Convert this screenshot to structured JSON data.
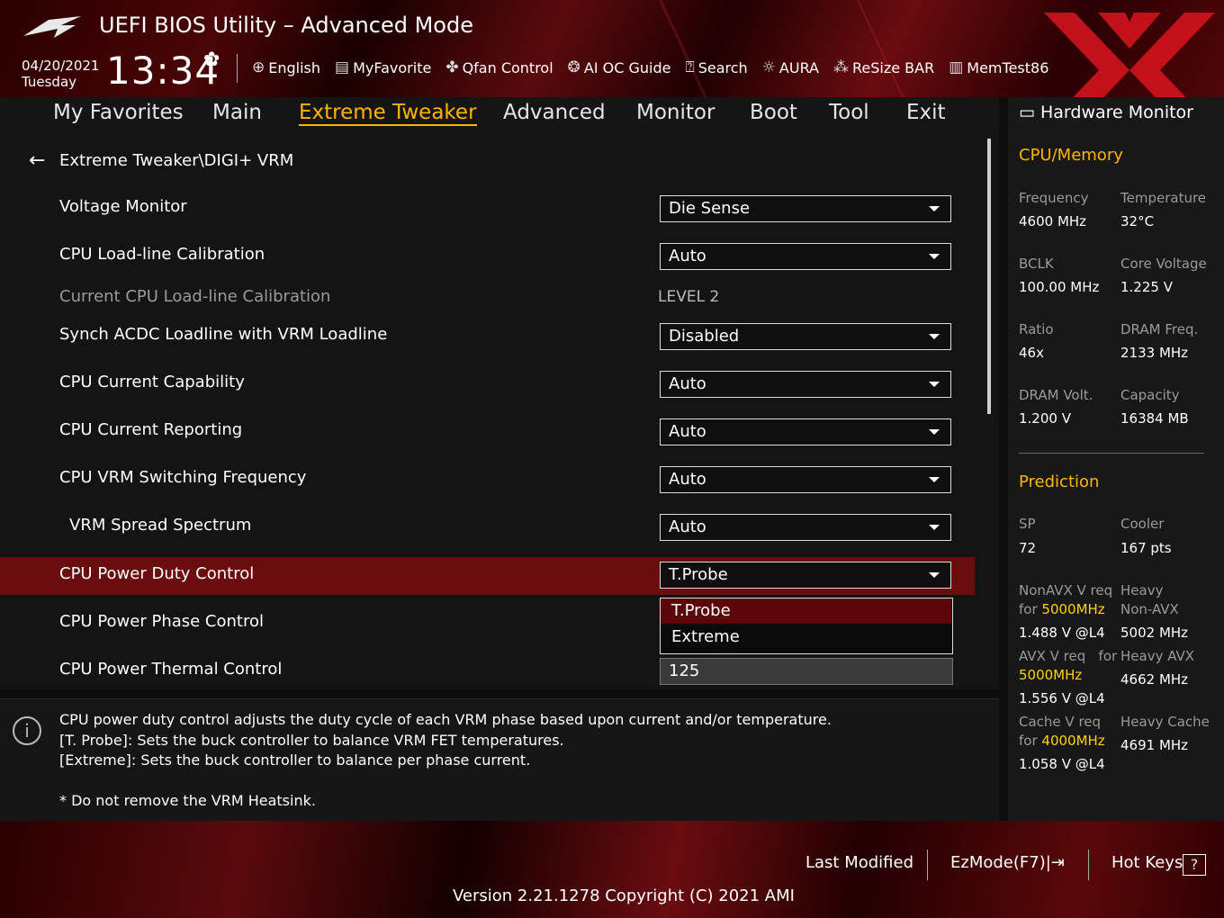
{
  "header": {
    "title": "UEFI BIOS Utility – Advanced Mode",
    "date": "04/20/2021",
    "weekday": "Tuesday",
    "time": "13:34",
    "toolbar": [
      {
        "label": "English",
        "icon": "globe-icon"
      },
      {
        "label": "MyFavorite",
        "icon": "favorite-icon"
      },
      {
        "label": "Qfan Control",
        "icon": "fan-icon"
      },
      {
        "label": "AI OC Guide",
        "icon": "ai-oc-icon"
      },
      {
        "label": "Search",
        "icon": "search-icon"
      },
      {
        "label": "AURA",
        "icon": "aura-icon"
      },
      {
        "label": "ReSize BAR",
        "icon": "resize-bar-icon"
      },
      {
        "label": "MemTest86",
        "icon": "memtest-icon"
      }
    ]
  },
  "tabs": [
    "My Favorites",
    "Main",
    "Extreme Tweaker",
    "Advanced",
    "Monitor",
    "Boot",
    "Tool",
    "Exit"
  ],
  "active_tab": "Extreme Tweaker",
  "breadcrumb": "Extreme Tweaker\\DIGI+ VRM",
  "settings": [
    {
      "label": "Voltage Monitor",
      "value": "Die Sense"
    },
    {
      "label": "CPU Load-line Calibration",
      "value": "Auto"
    },
    {
      "label": "Current CPU Load-line Calibration",
      "value": "LEVEL 2"
    },
    {
      "label": "Synch ACDC Loadline with VRM Loadline",
      "value": "Disabled"
    },
    {
      "label": "CPU Current Capability",
      "value": "Auto"
    },
    {
      "label": "CPU Current Reporting",
      "value": "Auto"
    },
    {
      "label": "CPU VRM Switching Frequency",
      "value": "Auto"
    },
    {
      "label": "VRM Spread Spectrum",
      "value": "Auto"
    },
    {
      "label": "CPU Power Duty Control",
      "value": "T.Probe"
    },
    {
      "label": "CPU Power Phase Control",
      "value": ""
    },
    {
      "label": "CPU Power Thermal Control",
      "value": "125"
    }
  ],
  "dropdown_options": [
    "T.Probe",
    "Extreme"
  ],
  "info": {
    "lines": [
      "CPU power duty control adjusts the duty cycle of each VRM phase based upon current and/or temperature.",
      "[T. Probe]: Sets the buck controller to balance VRM FET temperatures.",
      "[Extreme]: Sets the buck controller to balance per phase current.",
      "* Do not remove the VRM Heatsink."
    ]
  },
  "hw_monitor": {
    "title": "Hardware Monitor",
    "cpu_section": "CPU/Memory",
    "cpu": [
      {
        "label": "Frequency",
        "value": "4600 MHz"
      },
      {
        "label": "Temperature",
        "value": "32°C"
      },
      {
        "label": "BCLK",
        "value": "100.00 MHz"
      },
      {
        "label": "Core Voltage",
        "value": "1.225 V"
      },
      {
        "label": "Ratio",
        "value": "46x"
      },
      {
        "label": "DRAM Freq.",
        "value": "2133 MHz"
      },
      {
        "label": "DRAM Volt.",
        "value": "1.200 V"
      },
      {
        "label": "Capacity",
        "value": "16384 MB"
      }
    ],
    "prediction_section": "Prediction",
    "sp_label": "SP",
    "sp_value": "72",
    "cooler_label": "Cooler",
    "cooler_value": "167 pts",
    "nonavx_label": "NonAVX V req",
    "nonavx_for": "for",
    "nonavx_freq": "5000MHz",
    "nonavx_value": "1.488 V @L4",
    "heavy_nonavx_label1": "Heavy",
    "heavy_nonavx_label2": "Non-AVX",
    "heavy_nonavx_value": "5002 MHz",
    "avx_label": "AVX V req",
    "avx_for": "for",
    "avx_freq": "5000MHz",
    "avx_value": "1.556 V @L4",
    "heavy_avx_label": "Heavy AVX",
    "heavy_avx_value": "4662 MHz",
    "cache_label": "Cache V req",
    "cache_for": "for",
    "cache_freq": "4000MHz",
    "cache_value": "1.058 V @L4",
    "heavy_cache_label": "Heavy Cache",
    "heavy_cache_value": "4691 MHz"
  },
  "footer": {
    "last_modified": "Last Modified",
    "ezmode": "EzMode(F7)|",
    "hot_keys": "Hot Keys",
    "hot_keys_glyph": "?",
    "version": "Version 2.21.1278 Copyright (C) 2021 AMI"
  },
  "colors": {
    "accent": "#ffb400",
    "highlight": "#6b0c0f",
    "prediction_freq": "#ffd200"
  }
}
